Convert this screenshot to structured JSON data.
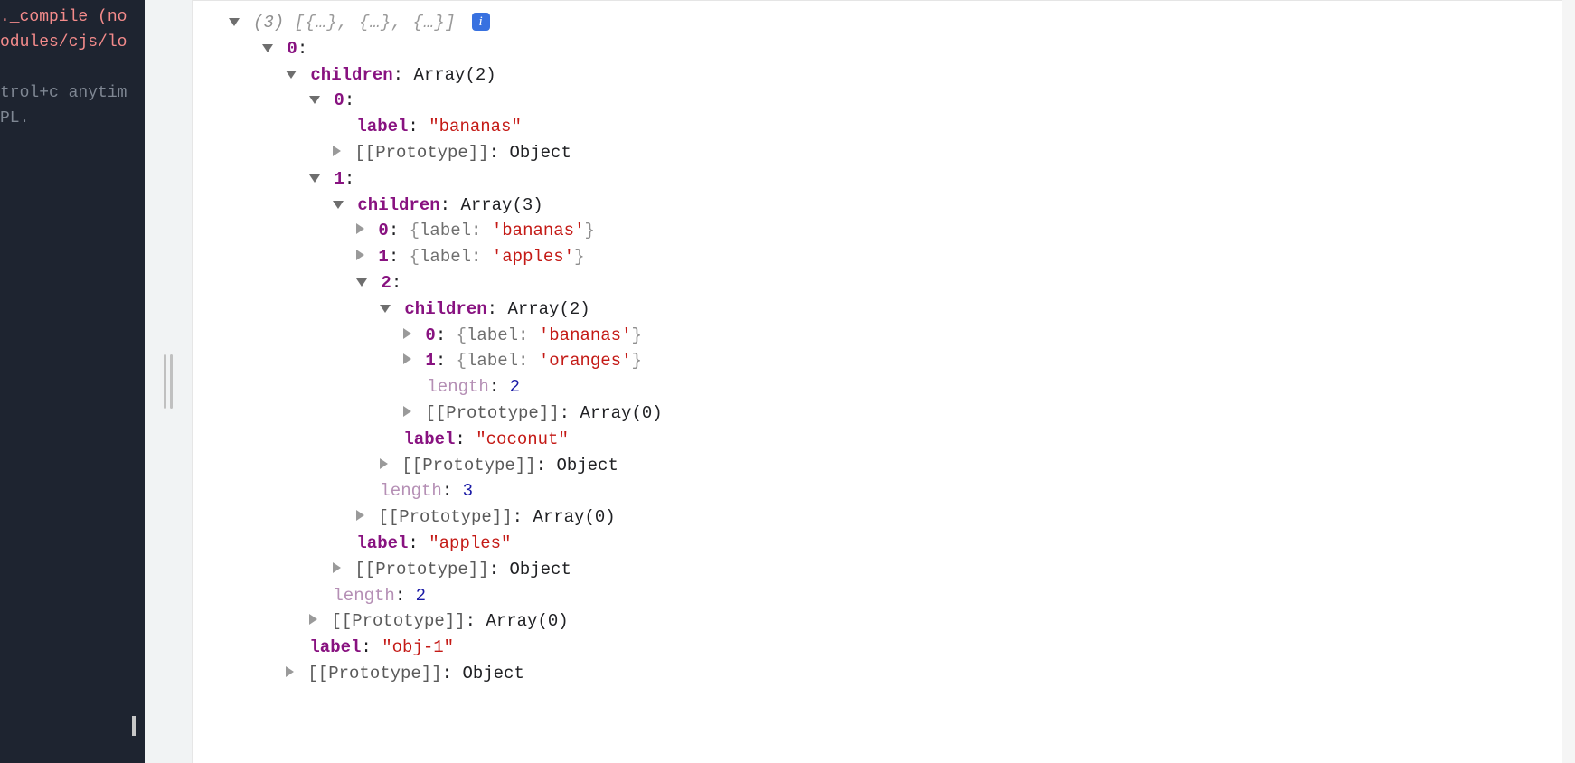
{
  "terminal": {
    "line1a": "._compile (no",
    "line1b": "odules/cjs/lo",
    "line2a": "trol+c anytim",
    "line2b": "PL."
  },
  "info_glyph": "i",
  "tree": {
    "header": {
      "count": "(3)",
      "preview": "[{…}, {…}, {…}]"
    },
    "n0": {
      "idx": "0",
      "children_key": "children",
      "children_type": "Array(2)",
      "c0": {
        "idx": "0",
        "label_key": "label",
        "label_val": "\"bananas\"",
        "proto_key": "[[Prototype]]",
        "proto_val": "Object"
      },
      "c1": {
        "idx": "1",
        "children_key": "children",
        "children_type": "Array(3)",
        "i0": {
          "idx": "0",
          "inline": "{label: 'bananas'}"
        },
        "i1": {
          "idx": "1",
          "inline": "{label: 'apples'}"
        },
        "i2": {
          "idx": "2",
          "children_key": "children",
          "children_type": "Array(2)",
          "j0": {
            "idx": "0",
            "inline": "{label: 'bananas'}"
          },
          "j1": {
            "idx": "1",
            "inline": "{label: 'oranges'}"
          },
          "length_key": "length",
          "length_val": "2",
          "proto_key": "[[Prototype]]",
          "proto_val": "Array(0)",
          "label_key": "label",
          "label_val": "\"coconut\"",
          "obj_proto_key": "[[Prototype]]",
          "obj_proto_val": "Object"
        },
        "length_key": "length",
        "length_val": "3",
        "proto_key": "[[Prototype]]",
        "proto_val": "Array(0)",
        "label_key": "label",
        "label_val": "\"apples\"",
        "obj_proto_key": "[[Prototype]]",
        "obj_proto_val": "Object"
      },
      "length_key": "length",
      "length_val": "2",
      "proto_key": "[[Prototype]]",
      "proto_val": "Array(0)",
      "label_key": "label",
      "label_val": "\"obj-1\"",
      "obj_proto_key": "[[Prototype]]",
      "obj_proto_val": "Object"
    }
  }
}
